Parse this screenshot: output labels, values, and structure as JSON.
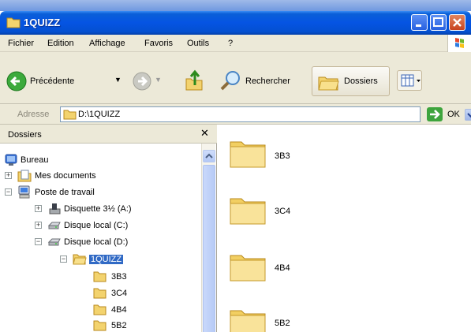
{
  "window": {
    "title": "1QUIZZ"
  },
  "menu": {
    "items": [
      "Fichier",
      "Edition",
      "Affichage",
      "Favoris",
      "Outils",
      "?"
    ]
  },
  "toolbar": {
    "back_label": "Précédente",
    "search_label": "Rechercher",
    "folders_label": "Dossiers"
  },
  "address": {
    "label": "Adresse",
    "value": "D:\\1QUIZZ",
    "go_label": "OK"
  },
  "folders_pane": {
    "title": "Dossiers",
    "close_glyph": "✕",
    "tree": [
      {
        "label": "Bureau",
        "icon": "desktop-icon",
        "expander": ""
      },
      {
        "label": "Mes documents",
        "icon": "documents-icon",
        "expander": "+"
      },
      {
        "label": "Poste de travail",
        "icon": "computer-icon",
        "expander": "−"
      },
      {
        "label": "Disquette 3½ (A:)",
        "icon": "floppy-icon",
        "expander": "+"
      },
      {
        "label": "Disque local (C:)",
        "icon": "drive-icon",
        "expander": "+"
      },
      {
        "label": "Disque local (D:)",
        "icon": "drive-icon",
        "expander": "−"
      },
      {
        "label": "1QUIZZ",
        "icon": "folder-open-icon",
        "expander": "−",
        "selected": true
      },
      {
        "label": "3B3",
        "icon": "folder-icon",
        "expander": ""
      },
      {
        "label": "3C4",
        "icon": "folder-icon",
        "expander": ""
      },
      {
        "label": "4B4",
        "icon": "folder-icon",
        "expander": ""
      },
      {
        "label": "5B2",
        "icon": "folder-icon",
        "expander": ""
      }
    ]
  },
  "content": {
    "folders": [
      "3B3",
      "3C4",
      "4B4",
      "5B2"
    ]
  },
  "colors": {
    "titlebar": "#0554e3",
    "selection": "#316ac5",
    "chrome": "#ece9d8",
    "folder": "#f6d77a"
  }
}
